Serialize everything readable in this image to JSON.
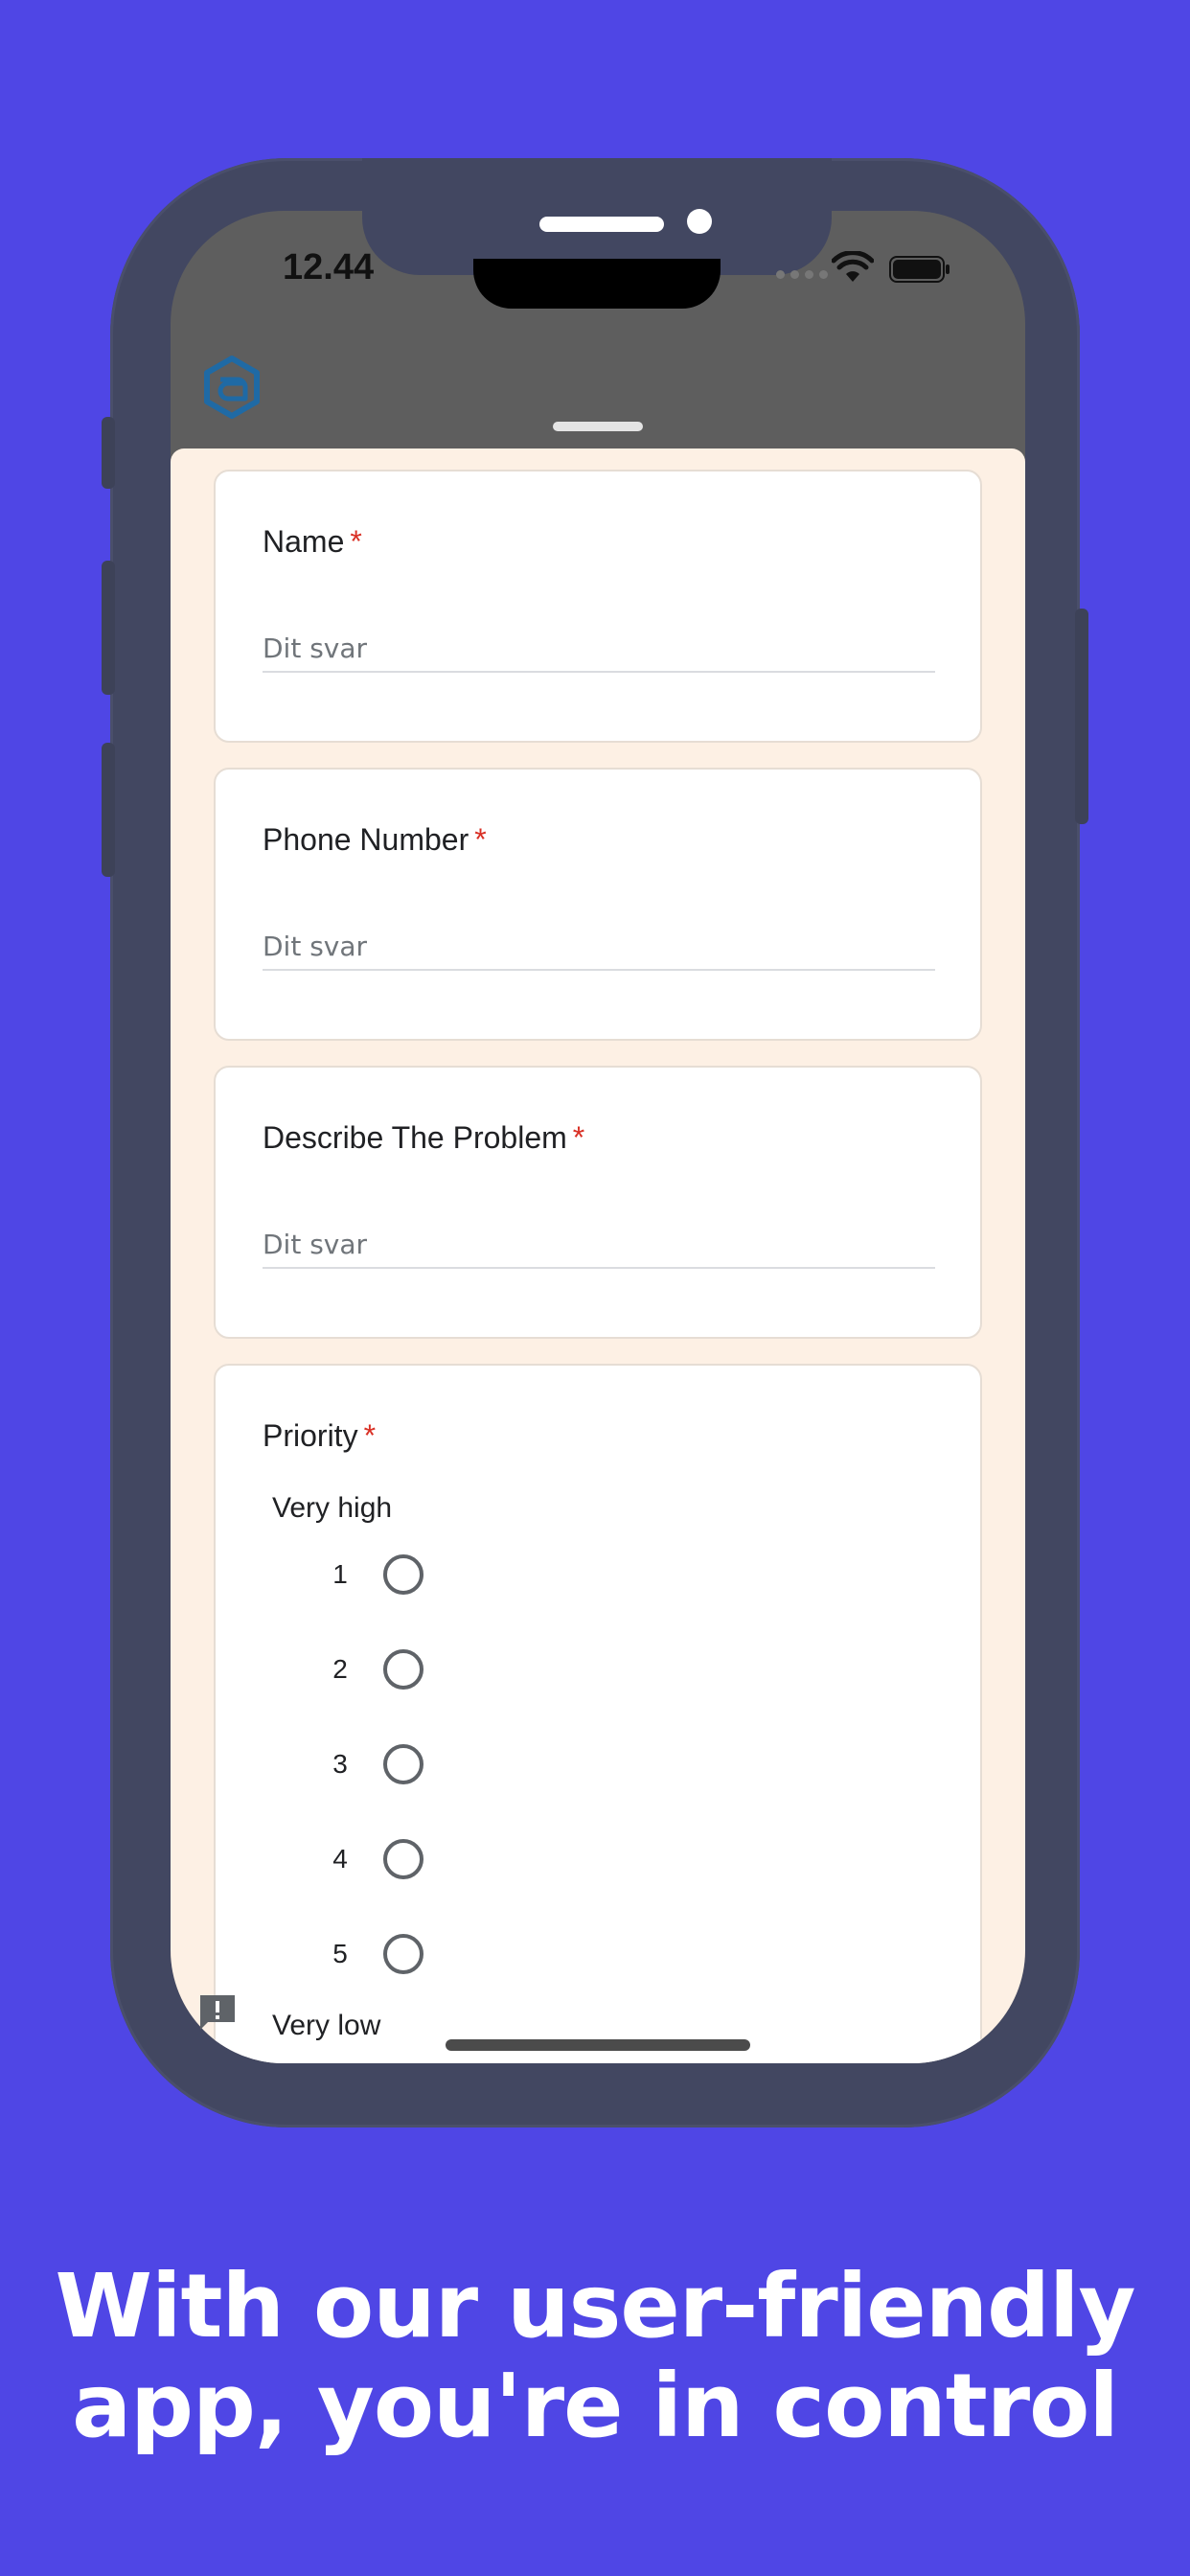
{
  "status_bar": {
    "time": "12.44"
  },
  "form": {
    "questions": [
      {
        "label": "Name",
        "required_mark": "*",
        "placeholder": "Dit svar"
      },
      {
        "label": "Phone Number",
        "required_mark": "*",
        "placeholder": "Dit svar"
      },
      {
        "label": "Describe The Problem",
        "required_mark": "*",
        "placeholder": "Dit svar"
      }
    ],
    "priority": {
      "label": "Priority",
      "required_mark": "*",
      "top_label": "Very high",
      "bottom_label": "Very low",
      "options": [
        "1",
        "2",
        "3",
        "4",
        "5"
      ]
    }
  },
  "tagline": {
    "line1": "With our user-friendly",
    "line2": "app, you're in control"
  },
  "colors": {
    "background": "#4f46e5",
    "phone_frame": "#424761",
    "sheet": "#fdf0e4",
    "required": "#d93025"
  }
}
